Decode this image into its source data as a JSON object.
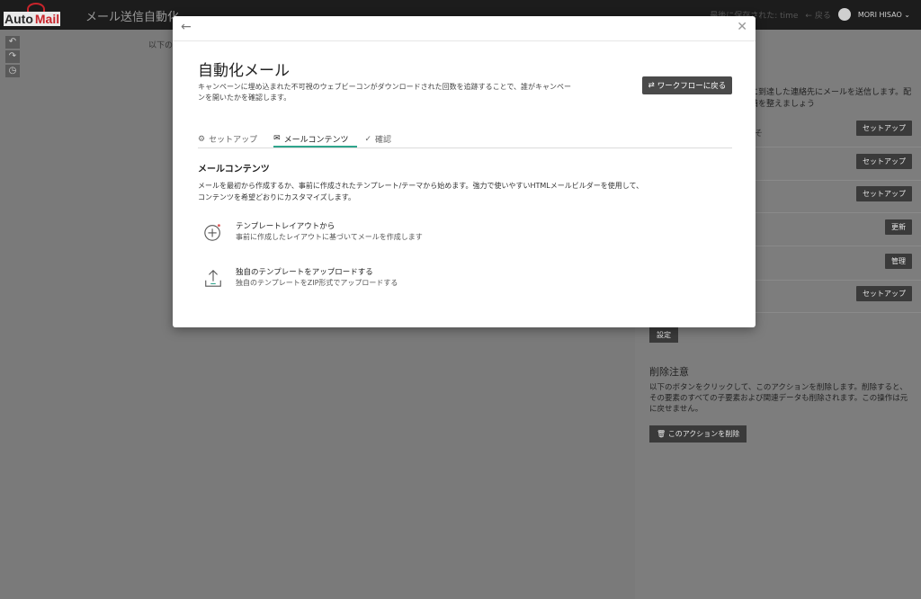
{
  "app": {
    "logo_auto": "Auto",
    "logo_mail": "Mail",
    "title": "メール送信自動化",
    "saved_text": "最後に保存された: time",
    "back_label": "戻る",
    "user_name": "MORI HISAO"
  },
  "background": {
    "partial_text": "以下の"
  },
  "right_panel": {
    "description": "ントに到達した連絡先にメールを送信します。配信準備を整えましょう",
    "rows": [
      {
        "label": "うこそ",
        "button": "セットアップ"
      },
      {
        "label": "",
        "button": "セットアップ"
      },
      {
        "label": "",
        "button": "セットアップ"
      },
      {
        "label": "",
        "button": "更新"
      },
      {
        "label": "",
        "button": "管理"
      },
      {
        "label": "",
        "button": "セットアップ"
      }
    ],
    "settings_button": "設定",
    "delete_title": "削除注意",
    "delete_desc": "以下のボタンをクリックして、このアクションを削除します。削除すると、その要素のすべての子要素および関連データも削除されます。この操作は元に戻せません。",
    "delete_button": "このアクションを削除"
  },
  "modal": {
    "title": "自動化メール",
    "description": "キャンペーンに埋め込まれた不可視のウェブビーコンがダウンロードされた回数を追跡することで、誰がキャンペーンを開いたかを確認します。",
    "workflow_button": "ワークフローに戻る",
    "tabs": [
      {
        "label": "セットアップ",
        "icon": "gear-icon"
      },
      {
        "label": "メールコンテンツ",
        "icon": "envelope-icon"
      },
      {
        "label": "確認",
        "icon": "check-icon"
      }
    ],
    "section_title": "メールコンテンツ",
    "section_desc": "メールを最初から作成するか、事前に作成されたテンプレート/テーマから始めます。強力で使いやすいHTMLメールビルダーを使用して、コンテンツを希望どおりにカスタマイズします。",
    "options": [
      {
        "title": "テンプレートレイアウトから",
        "subtitle": "事前に作成したレイアウトに基づいてメールを作成します",
        "icon": "plus-circle-icon"
      },
      {
        "title": "独自のテンプレートをアップロードする",
        "subtitle": "独自のテンプレートをZIP形式でアップロードする",
        "icon": "upload-icon"
      }
    ]
  }
}
